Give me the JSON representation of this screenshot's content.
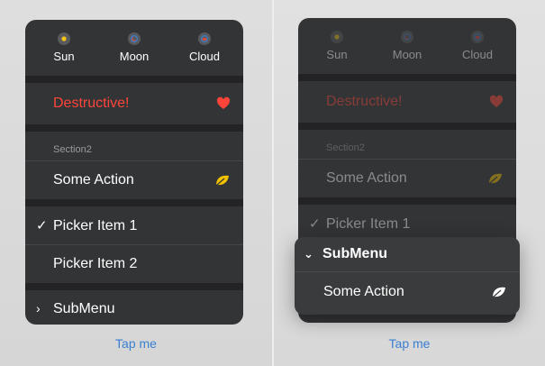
{
  "left": {
    "icons": [
      {
        "label": "Sun",
        "icon": "sun-icon",
        "color": "#f5c518"
      },
      {
        "label": "Moon",
        "icon": "moon-icon",
        "color": "#e04a3a"
      },
      {
        "label": "Cloud",
        "icon": "cloud-icon",
        "color": "#e04a3a"
      }
    ],
    "destructive_label": "Destructive!",
    "section_header": "Section2",
    "some_action_label": "Some Action",
    "picker_items": [
      {
        "label": "Picker Item 1",
        "checked": true
      },
      {
        "label": "Picker Item 2",
        "checked": false
      }
    ],
    "submenu_label": "SubMenu",
    "tap_label": "Tap me"
  },
  "right": {
    "icons": [
      {
        "label": "Sun",
        "icon": "sun-icon",
        "color": "#f5c518"
      },
      {
        "label": "Moon",
        "icon": "moon-icon",
        "color": "#e04a3a"
      },
      {
        "label": "Cloud",
        "icon": "cloud-icon",
        "color": "#e04a3a"
      }
    ],
    "destructive_label": "Destructive!",
    "section_header": "Section2",
    "some_action_label": "Some Action",
    "picker_item_label": "Picker Item 1",
    "submenu": {
      "title": "SubMenu",
      "item_label": "Some Action"
    },
    "tap_label": "Tap me"
  },
  "colors": {
    "destructive": "#ff453a",
    "leaf_yellow": "#f2c200",
    "link_blue": "#3a7fd0"
  }
}
